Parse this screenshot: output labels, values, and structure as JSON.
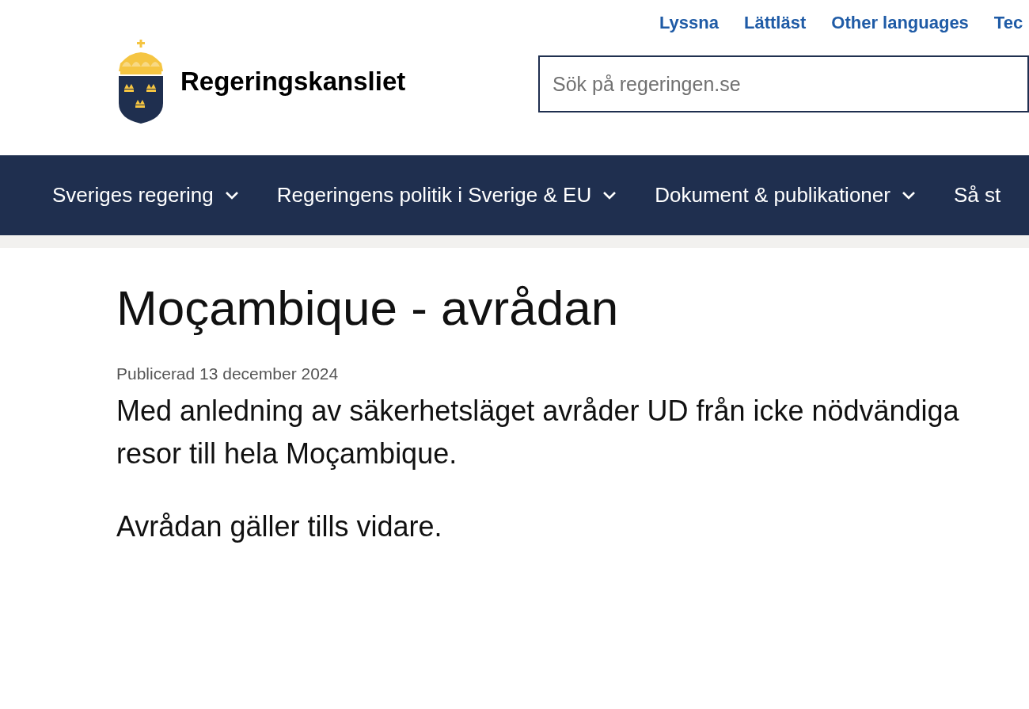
{
  "top_links": [
    "Lyssna",
    "Lättläst",
    "Other languages",
    "Tec"
  ],
  "logo": {
    "name": "Regeringskansliet"
  },
  "search": {
    "placeholder": "Sök på regeringen.se"
  },
  "nav": [
    {
      "label": "Sveriges regering",
      "has_dropdown": true
    },
    {
      "label": "Regeringens politik i Sverige & EU",
      "has_dropdown": true
    },
    {
      "label": "Dokument & publikationer",
      "has_dropdown": true
    },
    {
      "label": "Så st",
      "has_dropdown": false
    }
  ],
  "article": {
    "title": "Moçambique - avrådan",
    "published": "Publicerad 13 december 2024",
    "paragraphs": [
      "Med anledning av säkerhetsläget avråder UD från icke nödvändiga resor till hela Moçambique.",
      "Avrådan gäller tills vidare."
    ]
  }
}
